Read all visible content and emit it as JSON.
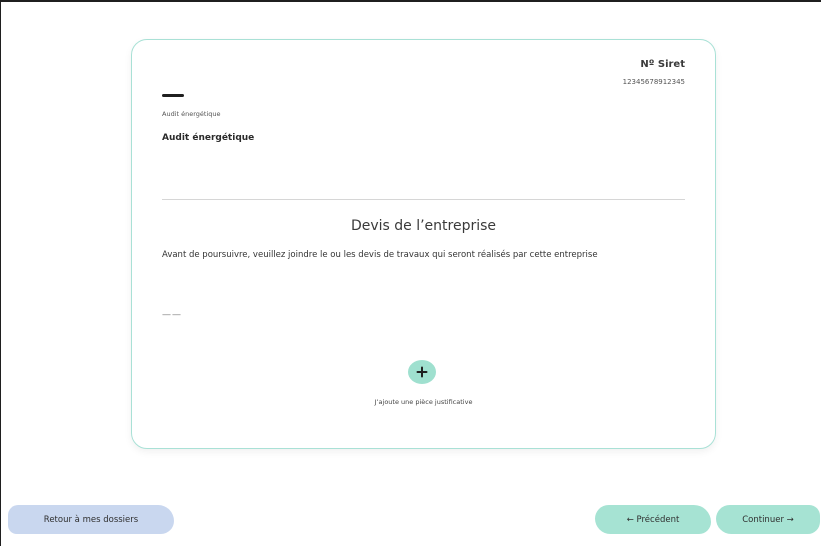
{
  "card": {
    "siret_label": "Nº Siret",
    "siret_value": "12345678912345",
    "category_small": "Audit énergétique",
    "category_title": "Audit énergétique",
    "section_title": "Devis de l’entreprise",
    "instructions": "Avant de poursuivre, veuillez joindre le ou les devis de travaux qui seront réalisés par cette entreprise",
    "empty_value": "——",
    "add_icon": "plus-icon",
    "add_label": "J’ajoute une pièce justificative"
  },
  "footer": {
    "back_label": "Retour à mes dossiers",
    "previous_label": "← Précédent",
    "continue_label": "Continuer →"
  },
  "colors": {
    "card_border": "#a9e1d6",
    "accent_green": "#a6e3d3",
    "back_blue": "#c9d7ef"
  }
}
